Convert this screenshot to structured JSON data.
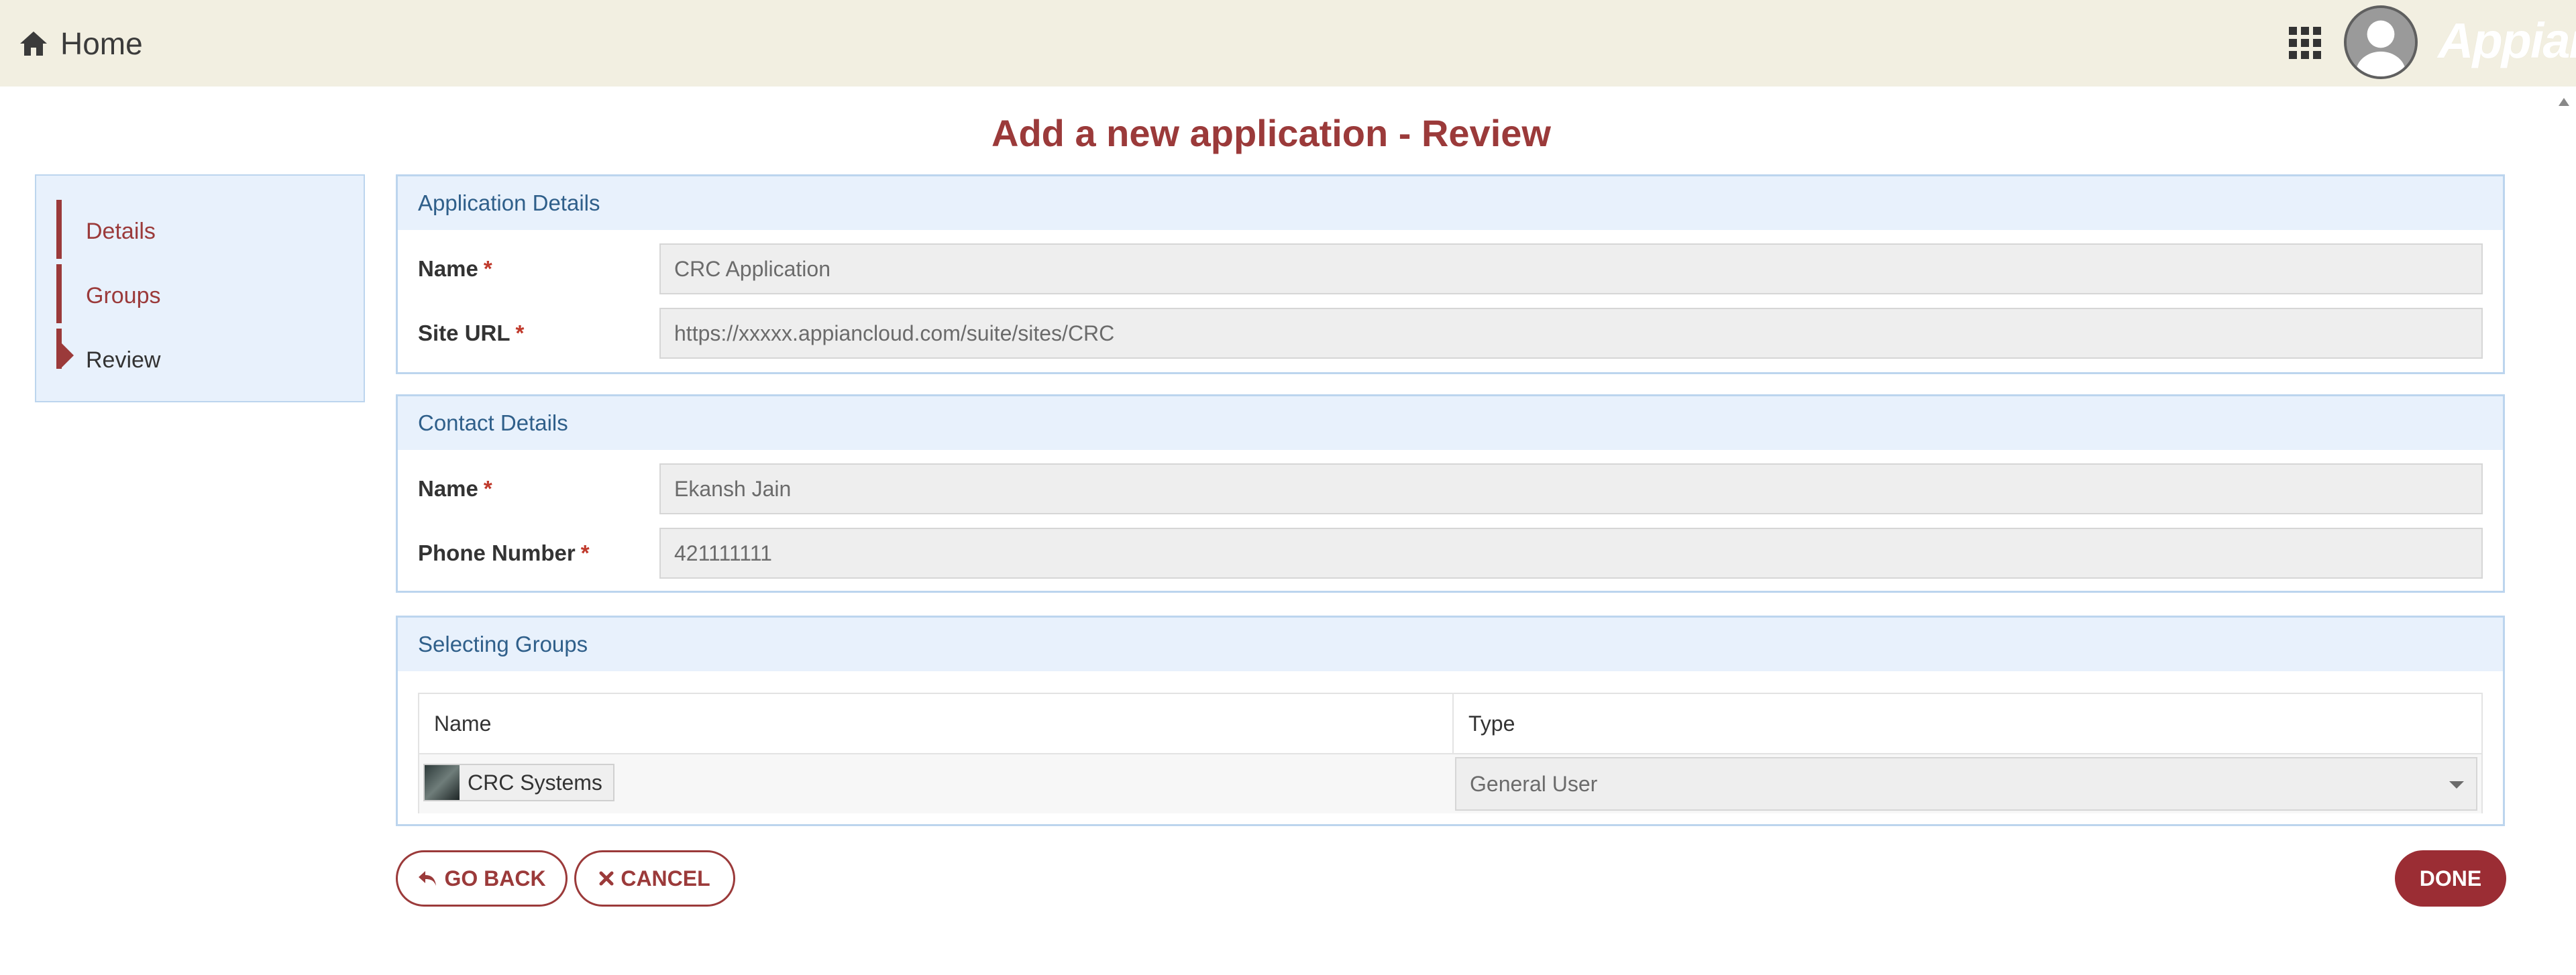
{
  "header": {
    "home_label": "Home",
    "brand": "Appian",
    "icons": [
      "home-icon",
      "app-grid-icon",
      "user-avatar"
    ]
  },
  "page": {
    "title": "Add a new application - Review"
  },
  "steps": [
    {
      "label": "Details",
      "state": "link"
    },
    {
      "label": "Groups",
      "state": "link"
    },
    {
      "label": "Review",
      "state": "current"
    }
  ],
  "application_details": {
    "heading": "Application Details",
    "name_label": "Name",
    "name_value": "CRC Application",
    "site_url_label": "Site URL",
    "site_url_value": "https://xxxxx.appiancloud.com/suite/sites/CRC",
    "required_marker": "*"
  },
  "contact_details": {
    "heading": "Contact Details",
    "name_label": "Name",
    "name_value": "Ekansh Jain",
    "phone_label": "Phone Number",
    "phone_value": "421111111",
    "required_marker": "*"
  },
  "groups": {
    "heading": "Selecting Groups",
    "columns": [
      "Name",
      "Type"
    ],
    "rows": [
      {
        "name": "CRC Systems",
        "type": "General User"
      }
    ]
  },
  "buttons": {
    "go_back": "GO BACK",
    "cancel": "CANCEL",
    "done": "DONE"
  },
  "colors": {
    "accent": "#9b3a3a",
    "header_bg": "#f2efe1",
    "section_bg": "#e8f1fc",
    "section_text": "#2f5f8a"
  }
}
